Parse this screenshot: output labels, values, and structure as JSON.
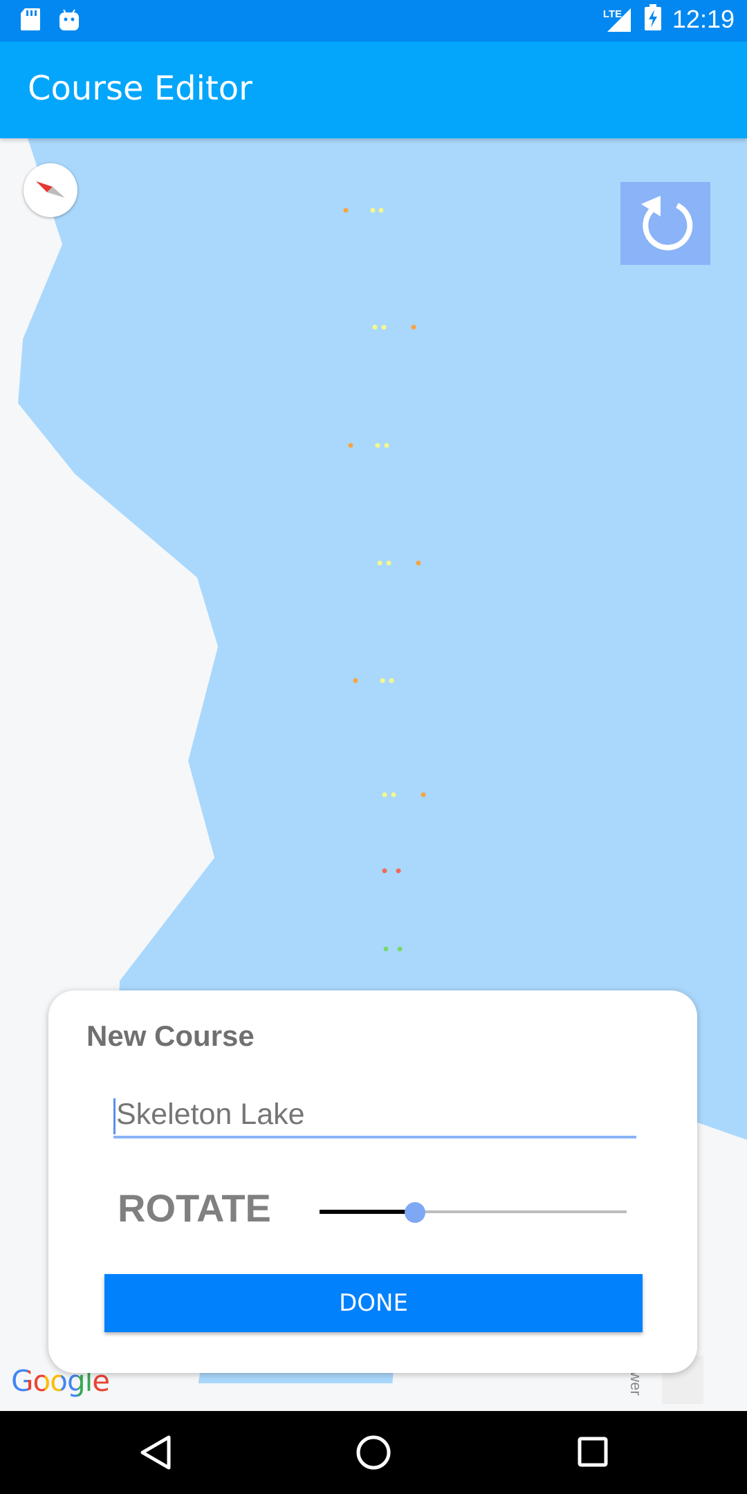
{
  "status_bar": {
    "time": "12:19",
    "network": "LTE",
    "icons": [
      "sd-card-icon",
      "android-icon",
      "lte-signal-icon",
      "battery-charging-icon"
    ]
  },
  "app_bar": {
    "title": "Course Editor"
  },
  "map": {
    "attribution": "Google",
    "edge_label": "ower",
    "water_color": "#aad8fc",
    "land_color": "#f6f7f9",
    "markers": [
      {
        "color": "#f7a43f",
        "kind": "orange"
      },
      {
        "color": "#f6f88a",
        "kind": "yellow"
      },
      {
        "color": "#ef6a5a",
        "kind": "red"
      },
      {
        "color": "#78d86a",
        "kind": "green"
      }
    ]
  },
  "controls": {
    "compass": "compass-icon",
    "reset": "refresh-icon"
  },
  "dialog": {
    "title": "New Course",
    "name_input": {
      "value": "",
      "placeholder": "Skeleton Lake"
    },
    "rotate_label": "ROTATE",
    "rotate_value": 0.31,
    "done_label": "DONE"
  },
  "nav_bar": {
    "icons": [
      "back-icon",
      "home-icon",
      "recents-icon"
    ]
  }
}
